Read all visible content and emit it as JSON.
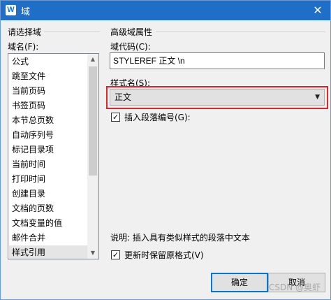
{
  "window": {
    "title": "域",
    "app_icon_letter": "W",
    "close_glyph": "✕"
  },
  "left_group": {
    "title": "请选择域",
    "field_names_label": "域名(F):",
    "items": [
      "公式",
      "跳至文件",
      "当前页码",
      "书签页码",
      "本节总页数",
      "自动序列号",
      "标记目录项",
      "当前时间",
      "打印时间",
      "创建目录",
      "文档的页数",
      "文档变量的值",
      "邮件合并",
      "样式引用"
    ],
    "selected_index": 13
  },
  "right_group": {
    "title": "高级域属性",
    "field_code_label": "域代码(C):",
    "field_code_value": "STYLEREF 正文 \\n",
    "style_name_label": "样式名(S):",
    "style_name_value": "正文",
    "insert_paragraph_number": {
      "label": "插入段落编号(G):",
      "checked": true
    },
    "description": "说明: 插入具有类似样式的段落中文本",
    "preserve_format": {
      "label": "更新时保留原格式(V)",
      "checked": true
    }
  },
  "buttons": {
    "ok": "确定",
    "cancel": "取消"
  },
  "watermark": "CSDN @奥虾",
  "colors": {
    "titlebar": "#1f6fc8",
    "highlight_border": "#e0262a",
    "default_button_border": "#0078d7"
  }
}
